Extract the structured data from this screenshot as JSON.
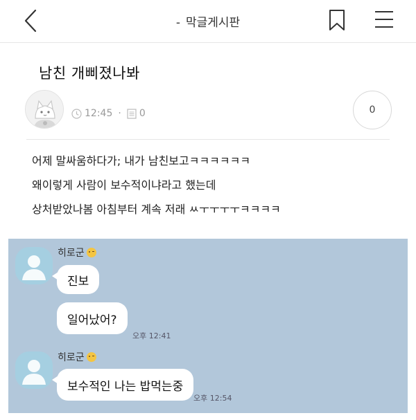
{
  "header": {
    "dash": "-",
    "board_name": "막글게시판"
  },
  "post": {
    "title": "남친 개삐졌나봐",
    "time": "12:45",
    "comment_count": "0",
    "like_count": "0",
    "body_lines": [
      "어제 말싸움하다가; 내가 남친보고ㅋㅋㅋㅋㅋㅋ",
      "왜이렇게 사람이 보수적이냐라고 했는데",
      "상처받았나봄 아침부터 계속 저래 ㅆㅜㅜㅜㅜㅋㅋㅋㅋ"
    ]
  },
  "chat": {
    "groups": [
      {
        "sender": "히로군",
        "messages": [
          {
            "text": "진보",
            "time": ""
          },
          {
            "text": "일어났어?",
            "time": "오후 12:41"
          }
        ]
      },
      {
        "sender": "히로군",
        "messages": [
          {
            "text": "보수적인 나는 밥먹는중",
            "time": "오후 12:54"
          }
        ]
      }
    ]
  },
  "icons": {
    "back": "chevron-left-icon",
    "bookmark": "bookmark-icon",
    "menu": "hamburger-menu-icon",
    "clock": "clock-icon",
    "comment": "comment-icon"
  },
  "colors": {
    "chat_background": "#b2c7da",
    "chat_avatar": "#a5cfe1",
    "bubble": "#ffffff"
  }
}
